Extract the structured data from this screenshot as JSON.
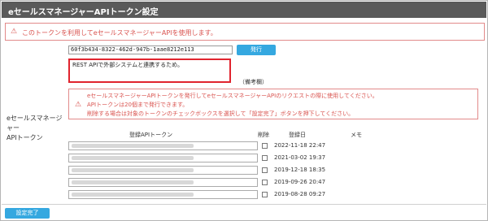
{
  "window": {
    "title": "eセールスマネージャーAPIトークン設定"
  },
  "alert_top": {
    "text": "このトークンを利用してeセールスマネージャーAPIを使用します。"
  },
  "side_label": {
    "line1": "eセールスマネージャー",
    "line2": "APIトークン"
  },
  "token": {
    "value": "60f3b434-8322-462d-947b-1aae8212e113",
    "issue_label": "発行"
  },
  "memo": {
    "value": "REST APIで外部システムと連携するため。",
    "label": "（備考欄）"
  },
  "info": {
    "lines": [
      "eセールスマネージャーAPIトークンを発行してeセールスマネージャーAPIのリクエストの際に使用してください。",
      "APIトークンは20個まで発行できます。",
      "削除する場合は対象のトークンのチェックボックスを選択して「設定完了」ボタンを押下してください。"
    ]
  },
  "table": {
    "headers": {
      "token": "登録APIトークン",
      "delete": "削除",
      "date": "登録日",
      "memo": "メモ"
    },
    "rows": [
      {
        "date": "2022-11-18 22:47"
      },
      {
        "date": "2021-03-02 19:37"
      },
      {
        "date": "2019-12-18 18:35"
      },
      {
        "date": "2019-09-26 20:47"
      },
      {
        "date": "2019-08-28 09:27"
      }
    ]
  },
  "footer": {
    "done_label": "設定完了"
  },
  "colors": {
    "titlebar": "#5a5a5a",
    "accent_button": "#35a8e0",
    "alert_text": "#d9534f",
    "highlight_border": "#e0242e"
  },
  "icons": {
    "alert": "warning-triangle-icon"
  }
}
